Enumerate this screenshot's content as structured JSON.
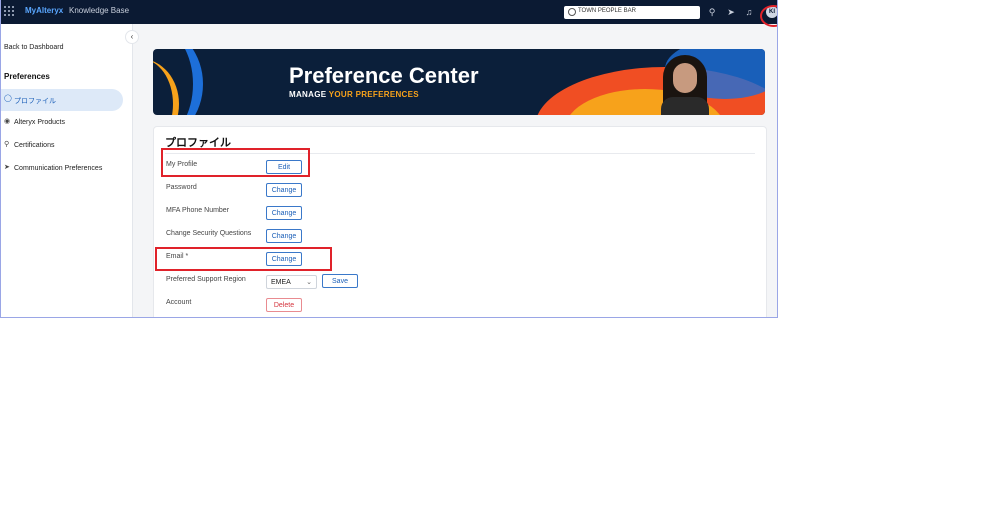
{
  "topbar": {
    "brand": "MyAlteryx",
    "kb": "Knowledge Base",
    "search_text": "TOWN PEOPLE BAR",
    "avatar_initials": "KI"
  },
  "sidebar": {
    "back_label": "Back to Dashboard",
    "section_title": "Preferences",
    "items": [
      {
        "label": "プロファイル",
        "icon": "user-icon",
        "active": true
      },
      {
        "label": "Alteryx Products",
        "icon": "pin-icon",
        "active": false
      },
      {
        "label": "Certifications",
        "icon": "badge-icon",
        "active": false
      },
      {
        "label": "Communication Preferences",
        "icon": "send-icon",
        "active": false
      }
    ]
  },
  "banner": {
    "title": "Preference Center",
    "sub_prefix": "MANAGE ",
    "sub_highlight": "YOUR PREFERENCES"
  },
  "profile": {
    "title": "プロファイル",
    "rows": [
      {
        "label": "My Profile",
        "action": "Edit"
      },
      {
        "label": "Password",
        "action": "Change"
      },
      {
        "label": "MFA Phone Number",
        "action": "Change"
      },
      {
        "label": "Change Security Questions",
        "action": "Change"
      },
      {
        "label": "Email *",
        "action": "Change"
      },
      {
        "label": "Preferred Support Region",
        "select_value": "EMEA",
        "action": "Save"
      },
      {
        "label": "Account",
        "action": "Delete"
      }
    ]
  },
  "colors": {
    "topbar": "#0b1a33",
    "accent": "#1b5fb8",
    "annotation": "#e0222a",
    "danger": "#d4343d"
  }
}
